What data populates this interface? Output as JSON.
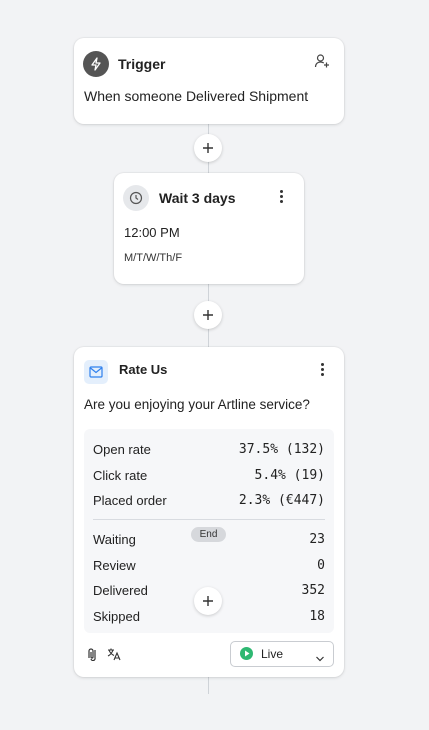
{
  "trigger": {
    "title": "Trigger",
    "description": "When someone Delivered Shipment",
    "icon": "bolt-icon",
    "action_icon": "add-person-icon"
  },
  "wait": {
    "title": "Wait 3 days",
    "time": "12:00 PM",
    "days": "M/T/W/Th/F",
    "icon": "clock-icon"
  },
  "email": {
    "title": "Rate Us",
    "subject": "Are you enjoying your Artline service?",
    "icon": "mail-icon",
    "accent": "#2f80ed",
    "stats": [
      {
        "label": "Open rate",
        "value": "37.5% (132)"
      },
      {
        "label": "Click rate",
        "value": "5.4% (19)"
      },
      {
        "label": "Placed order",
        "value": "2.3% (€447)"
      }
    ],
    "end_badge": "End",
    "branches": [
      {
        "label": "Waiting",
        "value": "23"
      },
      {
        "label": "Review",
        "value": "0"
      },
      {
        "label": "Delivered",
        "value": "352"
      },
      {
        "label": "Skipped",
        "value": "18"
      }
    ],
    "footer": {
      "status_label": "Live",
      "status_color": "#2eb872",
      "left_icons": [
        "paperclip-icon",
        "translate-icon"
      ]
    }
  }
}
